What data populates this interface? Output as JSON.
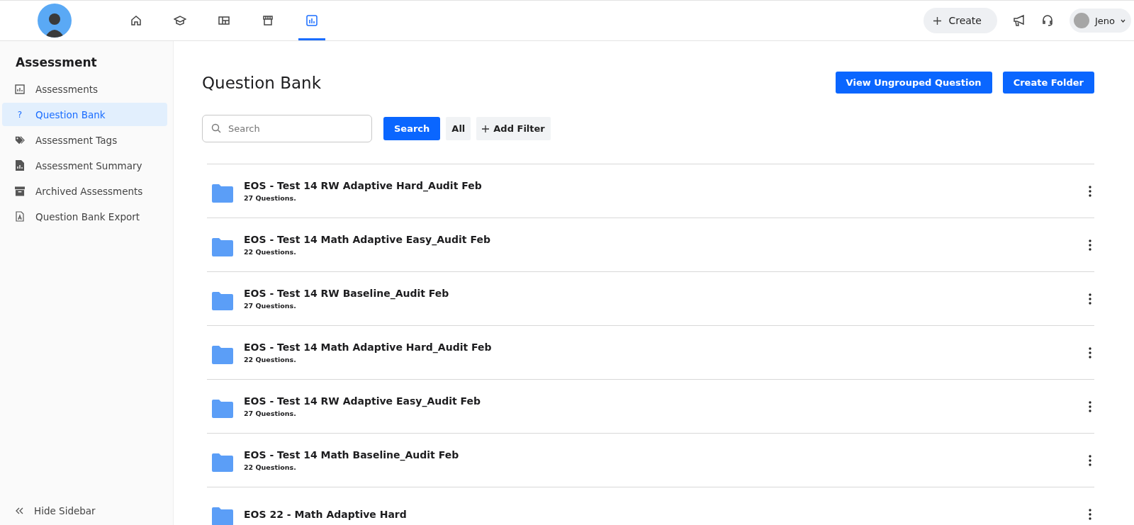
{
  "top_nav": {
    "items": [
      {
        "kind": "home",
        "selected": false
      },
      {
        "kind": "courses",
        "selected": false
      },
      {
        "kind": "layout",
        "selected": false
      },
      {
        "kind": "store",
        "selected": false
      },
      {
        "kind": "reports",
        "selected": true
      }
    ]
  },
  "header_actions": {
    "create_label": "Create",
    "user_name": "Jeno"
  },
  "sidebar": {
    "title": "Assessment",
    "items": [
      {
        "kind": "chart",
        "label": "Assessments",
        "selected": false
      },
      {
        "kind": "question",
        "icon_text": "?",
        "label": "Question Bank",
        "selected": true
      },
      {
        "kind": "tag",
        "label": "Assessment Tags",
        "selected": false
      },
      {
        "kind": "report",
        "label": "Assessment Summary",
        "selected": false
      },
      {
        "kind": "archive",
        "label": "Archived Assessments",
        "selected": false
      },
      {
        "kind": "pdf",
        "label": "Question Bank Export",
        "selected": false
      }
    ],
    "hide_label": "Hide Sidebar"
  },
  "page": {
    "title": "Question Bank",
    "buttons": [
      "View Ungrouped Question",
      "Create Folder"
    ]
  },
  "search": {
    "placeholder": "Search",
    "button": "Search",
    "filter_all": "All",
    "add_filter": "Add Filter"
  },
  "folders": [
    {
      "name": "EOS - Test 14 RW Adaptive Hard_Audit Feb",
      "count": "27 Questions."
    },
    {
      "name": "EOS - Test 14 Math Adaptive Easy_Audit Feb",
      "count": "22 Questions."
    },
    {
      "name": "EOS - Test 14 RW Baseline_Audit Feb",
      "count": "27 Questions."
    },
    {
      "name": "EOS - Test 14 Math Adaptive Hard_Audit Feb",
      "count": "22 Questions."
    },
    {
      "name": "EOS - Test 14 RW Adaptive Easy_Audit Feb",
      "count": "27 Questions."
    },
    {
      "name": "EOS - Test 14 Math Baseline_Audit Feb",
      "count": "22 Questions."
    },
    {
      "name": "EOS 22 - Math Adaptive Hard"
    }
  ]
}
